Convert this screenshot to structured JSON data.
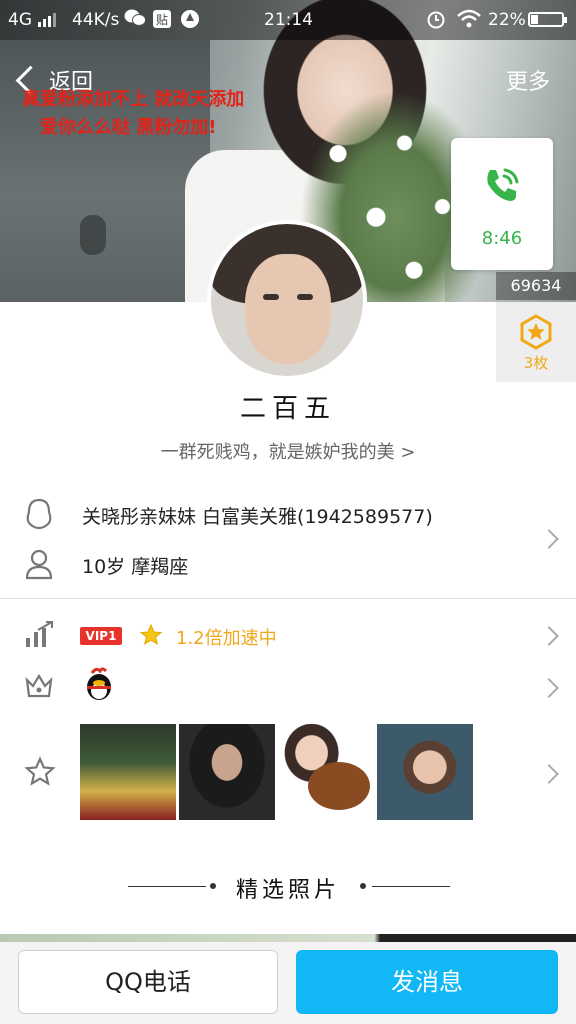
{
  "status_bar": {
    "network": "4G",
    "speed": "44K/s",
    "time": "21:14",
    "battery": "22%",
    "icons": [
      "signal-icon",
      "wechat-icon",
      "tieba-icon",
      "app-icon",
      "alarm-icon",
      "wifi-icon",
      "battery-icon"
    ]
  },
  "nav": {
    "back_label": "返回",
    "more_label": "更多"
  },
  "cover_note": {
    "line1": "真爱粉添加不上 就改天添加",
    "line2": "爱你么么哒 黑粉勿加!"
  },
  "call_tile": {
    "time": "8:46",
    "accent": "#37b54a"
  },
  "visitor_count": "69634",
  "likes": {
    "count_label": "3枚",
    "accent": "#f0a81a"
  },
  "profile": {
    "name": "二百五",
    "signature": "一群死贱鸡，就是嫉妒我的美 >"
  },
  "info": {
    "relationship": "关晓彤亲妹妹 白富美关雅(1942589577)",
    "basic": "10岁  摩羯座"
  },
  "vip": {
    "badge": "VIP1",
    "speed_text": "1.2倍加速中",
    "badge_color": "#e8322c"
  },
  "selected_photos": {
    "title": "精选照片"
  },
  "bottom_bar": {
    "call_label": "QQ电话",
    "message_label": "发消息",
    "message_color": "#12b7f5"
  }
}
